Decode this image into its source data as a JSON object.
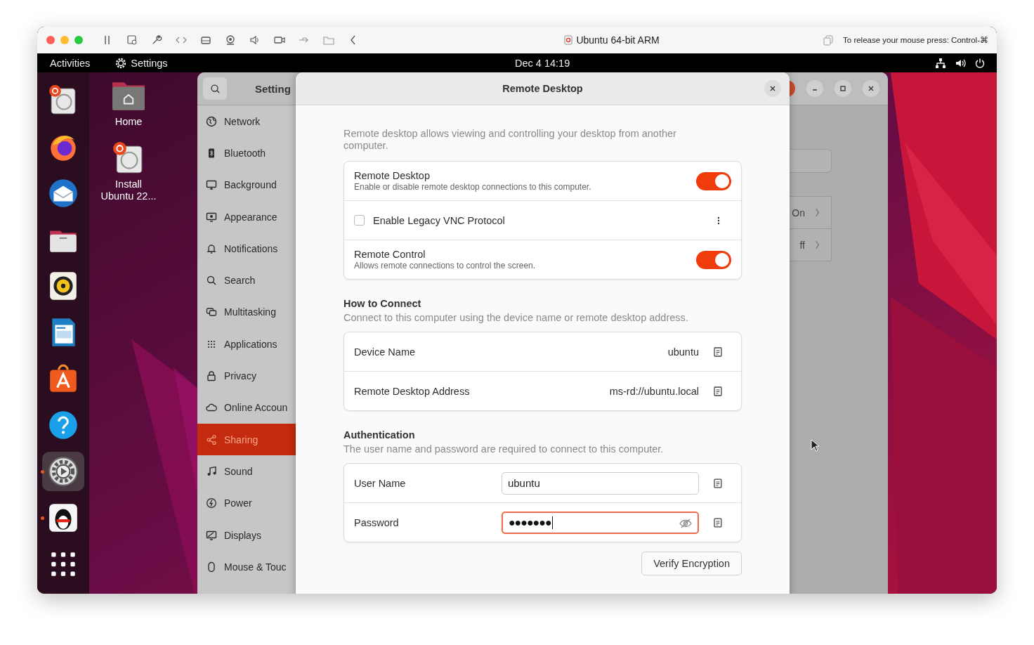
{
  "vm_window": {
    "title": "Ubuntu 64-bit ARM",
    "release_hint": "To release your mouse press: Control-⌘"
  },
  "top_bar": {
    "activities": "Activities",
    "app_menu": "Settings",
    "clock": "Dec 4  14:19"
  },
  "dock": [
    {
      "running": false,
      "selected": false
    },
    {
      "running": false,
      "selected": false
    },
    {
      "running": false,
      "selected": false
    },
    {
      "running": false,
      "selected": false
    },
    {
      "running": false,
      "selected": false
    },
    {
      "running": false,
      "selected": false
    },
    {
      "running": false,
      "selected": false
    },
    {
      "running": false,
      "selected": false
    },
    {
      "running": true,
      "selected": true
    },
    {
      "running": true,
      "selected": false
    },
    {
      "running": false,
      "selected": false
    }
  ],
  "desktop_icons": [
    {
      "label": "Home"
    },
    {
      "label": "Install Ubuntu 22..."
    }
  ],
  "settings_window": {
    "title": "Setting",
    "sidebar": [
      {
        "label": "Network",
        "selected": false
      },
      {
        "label": "Bluetooth",
        "selected": false
      },
      {
        "label": "Background",
        "selected": false
      },
      {
        "label": "Appearance",
        "selected": false
      },
      {
        "label": "Notifications",
        "selected": false
      },
      {
        "label": "Search",
        "selected": false
      },
      {
        "label": "Multitasking",
        "selected": false
      },
      {
        "label": "Applications",
        "selected": false
      },
      {
        "label": "Privacy",
        "selected": false
      },
      {
        "label": "Online Accoun",
        "selected": false
      },
      {
        "label": "Sharing",
        "selected": true
      },
      {
        "label": "Sound",
        "selected": false
      },
      {
        "label": "Power",
        "selected": false
      },
      {
        "label": "Displays",
        "selected": false
      },
      {
        "label": "Mouse & Touc",
        "selected": false
      }
    ],
    "panel_rows": [
      {
        "label": "On"
      },
      {
        "label": "ff"
      }
    ]
  },
  "dialog": {
    "title": "Remote Desktop",
    "description": "Remote desktop allows viewing and controlling your desktop from another computer.",
    "toggles": [
      {
        "kind": "switch",
        "title": "Remote Desktop",
        "subtitle": "Enable or disable remote desktop connections to this computer.",
        "on": true
      },
      {
        "kind": "checkbox",
        "title": "Enable Legacy VNC Protocol",
        "checked": false
      },
      {
        "kind": "switch",
        "title": "Remote Control",
        "subtitle": "Allows remote connections to control the screen.",
        "on": true
      }
    ],
    "connect": {
      "heading": "How to Connect",
      "subtitle": "Connect to this computer using the device name or remote desktop address.",
      "rows": [
        {
          "label": "Device Name",
          "value": "ubuntu"
        },
        {
          "label": "Remote Desktop Address",
          "value": "ms-rd://ubuntu.local"
        }
      ]
    },
    "auth": {
      "heading": "Authentication",
      "subtitle": "The user name and password are required to connect to this computer.",
      "rows": [
        {
          "kind": "text",
          "label": "User Name",
          "value": "ubuntu",
          "focused": false
        },
        {
          "kind": "password",
          "label": "Password",
          "value": "●●●●●●●",
          "focused": true
        }
      ]
    },
    "verify_button": "Verify Encryption"
  }
}
